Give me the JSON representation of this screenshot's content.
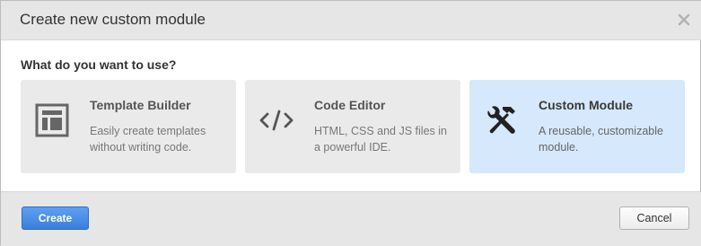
{
  "dialog": {
    "title": "Create new custom module",
    "close_icon": "close-x-icon"
  },
  "question": "What do you want to use?",
  "options": [
    {
      "title": "Template Builder",
      "description": "Easily create templates without writing code.",
      "icon": "layout-grid-icon",
      "selected": false
    },
    {
      "title": "Code Editor",
      "description": "HTML, CSS and JS files in a powerful IDE.",
      "icon": "code-brackets-icon",
      "selected": false
    },
    {
      "title": "Custom Module",
      "description": "A reusable, customizable module.",
      "icon": "wrench-hammer-icon",
      "selected": true
    }
  ],
  "footer": {
    "create_label": "Create",
    "cancel_label": "Cancel"
  },
  "colors": {
    "header_bg": "#e6e6e6",
    "card_bg": "#eaeaea",
    "selected_card_bg": "#d6e8fb",
    "primary_button": "#3a7fdc"
  }
}
